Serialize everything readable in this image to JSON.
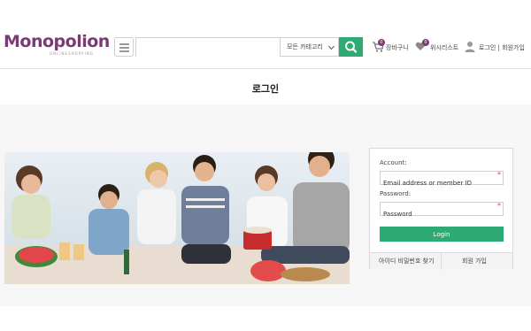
{
  "header": {
    "logo_text": "Monopolion",
    "logo_sub": "ONLINESHOPPING",
    "search": {
      "value": "",
      "placeholder": ""
    },
    "category_label": "모든 카테고리",
    "cart_label": "장바구니",
    "cart_count": "0",
    "wishlist_label": "위시리스트",
    "wishlist_count": "0",
    "account_label": "로그인 | 회원가입"
  },
  "page_title": "로그인",
  "login": {
    "account_label": "Account:",
    "account_placeholder": "Email address or member ID",
    "password_label": "Password:",
    "password_placeholder": "Password",
    "required_mark": "*",
    "login_button": "Login",
    "find_link": "아이디 비밀번호 찾기",
    "join_link": "회원 가입"
  },
  "colors": {
    "brand": "#7a3a72",
    "accent": "#2eaa74",
    "required": "#e23b3b"
  },
  "icons": [
    "menu-icon",
    "search-icon",
    "cart-icon",
    "heart-icon",
    "user-icon",
    "chevron-down-icon"
  ]
}
